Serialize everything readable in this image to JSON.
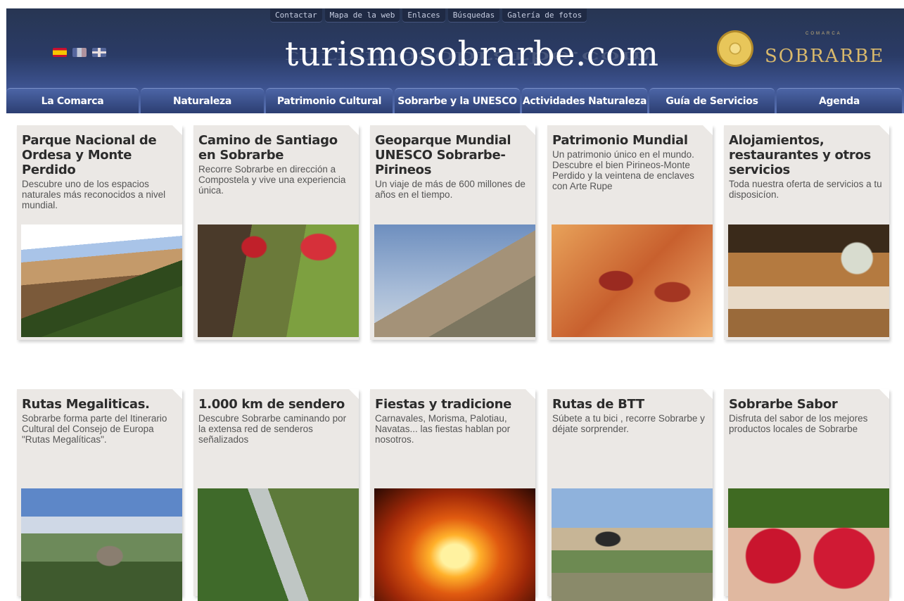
{
  "top_links": [
    "Contactar",
    "Mapa de la web",
    "Enlaces",
    "Búsquedas",
    "Galería de fotos"
  ],
  "languages": [
    "es",
    "fr",
    "en"
  ],
  "site_title": "turismosobrarbe.com",
  "logo": {
    "small_text": "COMARCA",
    "text": "SOBRARBE"
  },
  "nav": [
    "La Comarca",
    "Naturaleza",
    "Patrimonio Cultural",
    "Sobrarbe y la UNESCO",
    "Actividades Naturaleza",
    "Guía de Servicios",
    "Agenda"
  ],
  "cards": [
    {
      "title": "Parque Nacional de Ordesa y Monte Perdido",
      "desc": "Descubre uno de los espacios naturales más reconocidos a nivel mundial.",
      "image": "mountain-valley-photo"
    },
    {
      "title": "Camino de Santiago en Sobrarbe",
      "desc": "Recorre Sobrarbe en dirección a Compostela y vive una experiencia única.",
      "image": "hikers-photo"
    },
    {
      "title": "Geoparque Mundial UNESCO Sobrarbe-Pirineos",
      "desc": "Un viaje de más de 600 millones de años en el tiempo.",
      "image": "rock-peak-photo"
    },
    {
      "title": "Patrimonio Mundial",
      "desc": "Un patrimonio único en el mundo. Descubre el bien Pirineos-Monte Perdido y la veintena de enclaves con Arte Rupe",
      "image": "cave-painting-photo"
    },
    {
      "title": "Alojamientos, restaurantes y otros servicios",
      "desc": "Toda nuestra oferta de servicios a tu disposicíon.",
      "image": "restaurant-table-photo"
    },
    {
      "title": "Rutas Megaliticas.",
      "desc": "Sobrarbe forma parte del Itinerario Cultural del Consejo de Europa \"Rutas Megalíticas\".",
      "image": "dolmen-photo"
    },
    {
      "title": "1.000 km de sendero",
      "desc": "Descubre Sobrarbe caminando por la extensa red de senderos señalizados",
      "image": "waterfall-trail-photo"
    },
    {
      "title": "Fiestas y tradicione",
      "desc": "Carnavales, Morisma, Palotiau, Navatas... las fiestas hablan por nosotros.",
      "image": "bonfire-photo"
    },
    {
      "title": "Rutas de BTT",
      "desc": "Súbete a tu bici , recorre Sobrarbe y déjate sorprender.",
      "image": "mountain-biker-photo"
    },
    {
      "title": "Sobrarbe Sabor",
      "desc": "Disfruta del sabor de los mejores productos locales de Sobrarbe",
      "image": "raspberries-photo"
    }
  ]
}
